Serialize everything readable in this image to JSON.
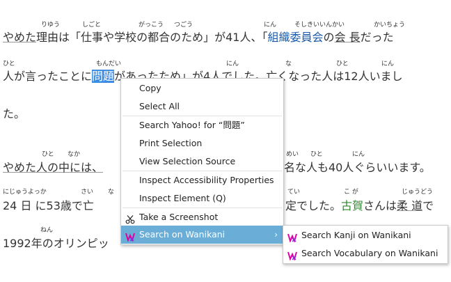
{
  "page": {
    "line1": {
      "prefix": "やめた",
      "riyuu": "理由",
      "wa": "は「",
      "shigoto": "仕事",
      "ya": "や",
      "gakkou": "学校",
      "no": "の",
      "tsugou": "都合",
      "notame": "のため」が41",
      "nin": "人",
      "kagi": "、「",
      "soshiki": "組織委員会",
      "no2": "の",
      "kaichou": "会 長",
      "datta": "だった"
    },
    "furi1": [
      "りゆう",
      "しごと",
      "がっこう",
      "つごう",
      "にん",
      "そしきいいんかい",
      "かいちょう"
    ],
    "line2": {
      "hito": "人",
      "ga": "が言ったことに",
      "mondai": "問題",
      "rest": "があったため」が4人でした。亡くなった人は12人いまし"
    },
    "furi2": [
      "ひと",
      "もんだい",
      "にん",
      "な",
      "ひと",
      "にん"
    ],
    "line3": "た。",
    "line4": {
      "a": "やめた人の中には、",
      "b": "名な人も40人ぐらいいます。"
    },
    "furi4": [
      "ひと",
      "なか",
      "めい",
      "ひと",
      "にん"
    ],
    "line5": {
      "a": " 24  日 に53歳で亡",
      "b": "定でした。",
      "koga": "古賀",
      "c": "さんは",
      "juudou": "柔 道",
      "d": "で"
    },
    "furi5": [
      "にじゅうよっか",
      "さい",
      "な",
      "てい",
      "こ が",
      "じゅうどう"
    ],
    "line6": "1992年のオリンピッ",
    "furi6": [
      "ねん"
    ]
  },
  "context_menu": {
    "items": [
      {
        "label": "Copy"
      },
      {
        "label": "Select All"
      },
      {
        "label": "Search Yahoo! for “問題”"
      },
      {
        "label": "Print Selection"
      },
      {
        "label": "View Selection Source"
      },
      {
        "label": "Inspect Accessibility Properties"
      },
      {
        "label": "Inspect Element (Q)"
      },
      {
        "label": "Take a Screenshot",
        "icon": "scissors-icon"
      },
      {
        "label": "Search on Wanikani",
        "icon": "wanikani-icon",
        "submenu_arrow": "›"
      }
    ]
  },
  "submenu": {
    "items": [
      {
        "label": "Search Kanji on Wanikani",
        "icon": "wanikani-icon"
      },
      {
        "label": "Search Vocabulary on Wanikani",
        "icon": "wanikani-icon"
      }
    ]
  },
  "colors": {
    "selection": "#3d8ee3",
    "menu_highlight": "#6aaed8",
    "link_blue": "#1a5aa8",
    "name_green": "#2d8a2d",
    "wanikani_pink": "#e000a0",
    "wanikani_purple": "#8a2be2"
  }
}
